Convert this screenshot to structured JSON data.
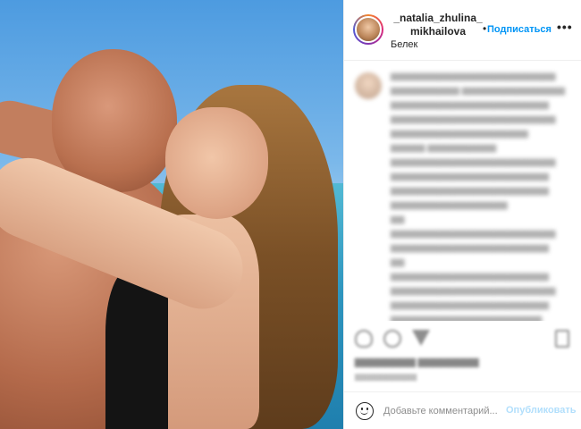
{
  "photo": {
    "alt_subject": "couple-on-beach"
  },
  "header": {
    "username_line1": "_natalia_zhulina_",
    "username_line2": "mikhailova",
    "separator": "•",
    "follow_label": "Подписаться",
    "more_label": "•••",
    "location": "Белек"
  },
  "comment_bar": {
    "placeholder": "Добавьте комментарий...",
    "post_label": "Опубликовать"
  },
  "colors": {
    "follow_blue": "#0095f6",
    "post_disabled_blue": "#b2dffc",
    "text": "#262626",
    "muted": "#8e8e8e"
  }
}
